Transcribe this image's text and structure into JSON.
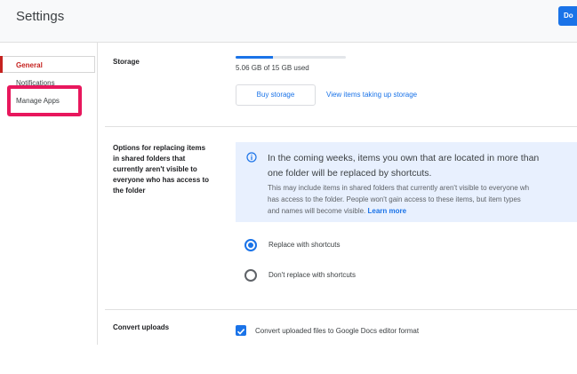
{
  "header": {
    "title": "Settings",
    "done_label": "Do"
  },
  "sidebar": {
    "items": [
      {
        "label": "General"
      },
      {
        "label": "Notifications"
      },
      {
        "label": "Manage Apps"
      }
    ]
  },
  "storage": {
    "label": "Storage",
    "usage_text": "5.06 GB of 15 GB used",
    "used_fraction": 0.34,
    "buy_label": "Buy storage",
    "view_link": "View items taking up storage"
  },
  "shortcuts": {
    "label_lines": [
      "Options for replacing items",
      "in shared folders that",
      "currently aren't visible to",
      "everyone who has access to",
      "the folder"
    ],
    "info_title_lines": [
      "In the coming weeks, items you own that are located in more than",
      "one folder will be replaced by shortcuts."
    ],
    "info_body_lines": [
      "This may include items in shared folders that currently aren't visible to everyone wh",
      "has access to the folder. People won't gain access to these items, but item types",
      "and names will become visible."
    ],
    "learn_more": "Learn more",
    "options": [
      {
        "label": "Replace with shortcuts",
        "selected": true
      },
      {
        "label": "Don't replace with shortcuts",
        "selected": false
      }
    ]
  },
  "convert": {
    "label": "Convert uploads",
    "checkbox_label": "Convert uploaded files to Google Docs editor format",
    "checked": true
  },
  "colors": {
    "accent": "#1a73e8",
    "nav_active": "#c5221f",
    "highlight": "#e8175d",
    "info_bg": "#e8f0fe"
  }
}
